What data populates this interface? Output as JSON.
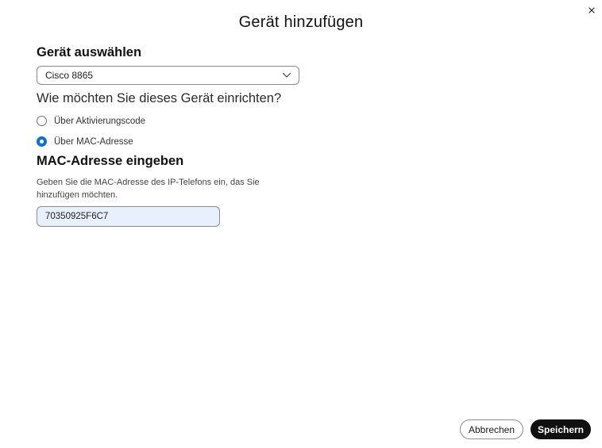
{
  "dialog": {
    "title": "Gerät hinzufügen",
    "close_icon": "close-icon"
  },
  "device": {
    "heading": "Gerät auswählen",
    "selected": "Cisco 8865",
    "chevron_icon": "chevron-down-icon"
  },
  "setup": {
    "question": "Wie möchten Sie dieses Gerät einrichten?",
    "options": [
      {
        "label": "Über Aktivierungscode",
        "checked": false
      },
      {
        "label": "Über MAC-Adresse",
        "checked": true
      }
    ]
  },
  "mac": {
    "heading": "MAC-Adresse eingeben",
    "help": "Geben Sie die MAC-Adresse des IP-Telefons ein, das Sie hinzufügen möchten.",
    "value": "70350925F6C7"
  },
  "footer": {
    "cancel_label": "Abbrechen",
    "save_label": "Speichern"
  },
  "colors": {
    "accent": "#1170cf",
    "input_fill": "#e8f0fe",
    "primary_button": "#111111"
  }
}
